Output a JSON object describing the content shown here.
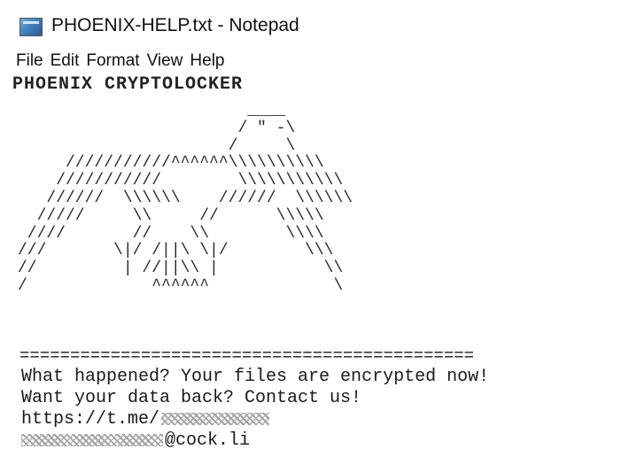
{
  "window": {
    "title": "PHOENIX-HELP.txt - Notepad",
    "icon": "notepad-icon"
  },
  "menu": {
    "items": [
      "File",
      "Edit",
      "Format",
      "View",
      "Help"
    ]
  },
  "document": {
    "heading": "PHOENIX CRYPTOLOCKER",
    "ascii_art": "                        ____\n                       / \" -\\\n                      /     \\\n     ///////////^^^^^^\\\\\\\\\\\\\\\\\\\\\n    ///////////        \\\\\\\\\\\\\\\\\\\\\\\n   //////  \\\\\\\\\\\\    //////  \\\\\\\\\\\\\n  /////     \\\\     //      \\\\\\\\\\\n ////       //    \\\\        \\\\\\\\\n///       \\|/ /||\\ \\|/        \\\\\\\n//         | //||\\\\ |           \\\\\n/             ^^^^^^             \\",
    "separator": "=============================================",
    "line1": "What happened? Your files are encrypted now!",
    "line2": "Want your data back? Contact us!",
    "line3_prefix": "https://t.me/",
    "line4_suffix": "@cock.li"
  }
}
